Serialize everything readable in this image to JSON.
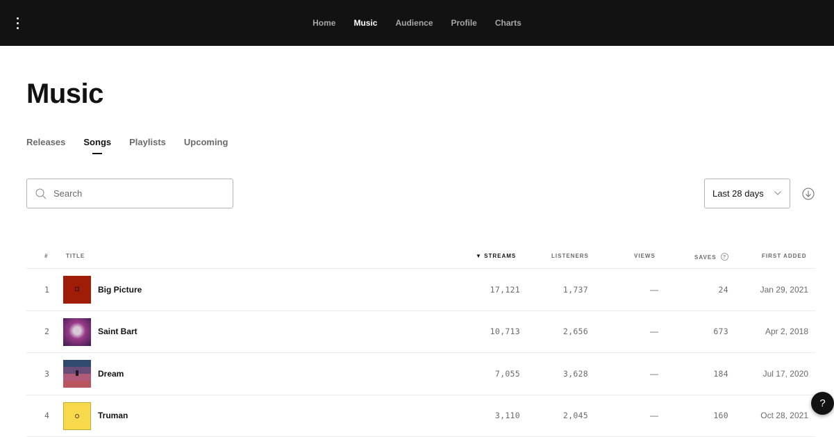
{
  "topbar": {
    "menu_icon": "kebab-menu-icon",
    "nav": [
      {
        "label": "Home",
        "active": false
      },
      {
        "label": "Music",
        "active": true
      },
      {
        "label": "Audience",
        "active": false
      },
      {
        "label": "Profile",
        "active": false
      },
      {
        "label": "Charts",
        "active": false
      }
    ]
  },
  "page": {
    "title": "Music",
    "tabs": [
      {
        "label": "Releases",
        "active": false
      },
      {
        "label": "Songs",
        "active": true
      },
      {
        "label": "Playlists",
        "active": false
      },
      {
        "label": "Upcoming",
        "active": false
      }
    ]
  },
  "search": {
    "placeholder": "Search",
    "value": "",
    "icon": "search-icon"
  },
  "range": {
    "selected": "Last 28 days",
    "icon": "chevron-down-icon"
  },
  "download": {
    "icon": "download-icon"
  },
  "table": {
    "columns": {
      "index": "#",
      "title": "Title",
      "streams": "Streams",
      "listeners": "Listeners",
      "views": "Views",
      "saves": "Saves",
      "first_added": "First Added"
    },
    "sort": {
      "column": "streams",
      "direction": "desc",
      "icon": "sort-down-triangle-icon"
    },
    "saves_help_icon": "question-circle-icon",
    "rows": [
      {
        "index": "1",
        "title": "Big Picture",
        "streams": "17,121",
        "listeners": "1,737",
        "views": "—",
        "saves": "24",
        "first_added": "Jan 29, 2021",
        "art_color": "#a01c06"
      },
      {
        "index": "2",
        "title": "Saint Bart",
        "streams": "10,713",
        "listeners": "2,656",
        "views": "—",
        "saves": "673",
        "first_added": "Apr 2, 2018",
        "art_color": "#7a2d6b"
      },
      {
        "index": "3",
        "title": "Dream",
        "streams": "7,055",
        "listeners": "3,628",
        "views": "—",
        "saves": "184",
        "first_added": "Jul 17, 2020",
        "art_color": "#a05a72"
      },
      {
        "index": "4",
        "title": "Truman",
        "streams": "3,110",
        "listeners": "2,045",
        "views": "—",
        "saves": "160",
        "first_added": "Oct 28, 2021",
        "art_color": "#f9d94c"
      }
    ]
  },
  "help_fab": {
    "label": "?"
  }
}
